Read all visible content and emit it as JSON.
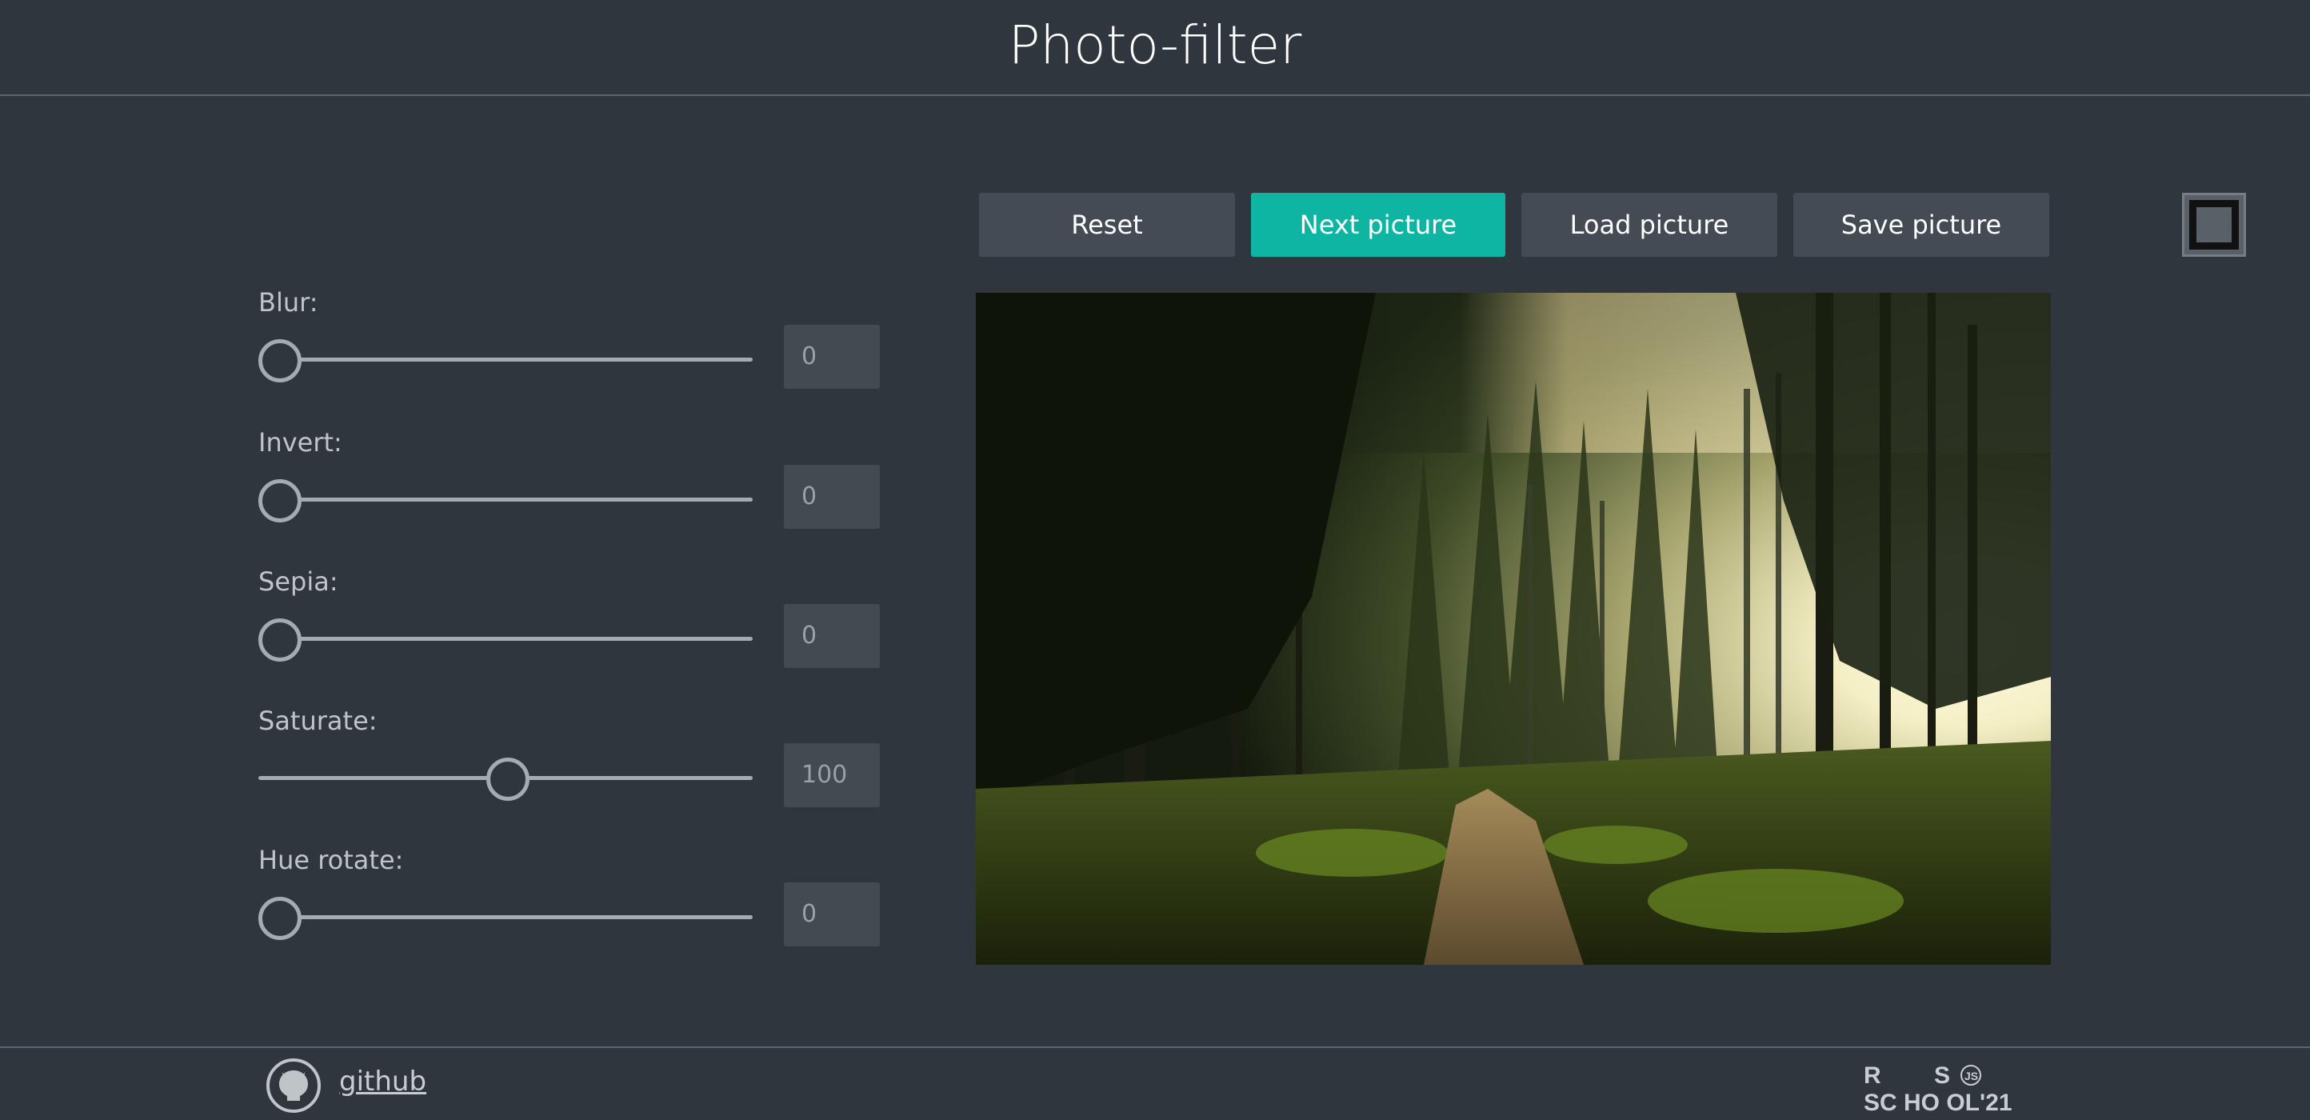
{
  "header": {
    "title": "Photo-filter"
  },
  "filters": [
    {
      "label": "Blur:",
      "value": "0",
      "fraction": 0.0
    },
    {
      "label": "Invert:",
      "value": "0",
      "fraction": 0.0
    },
    {
      "label": "Sepia:",
      "value": "0",
      "fraction": 0.0
    },
    {
      "label": "Saturate:",
      "value": "100",
      "fraction": 0.5
    },
    {
      "label": "Hue rotate:",
      "value": "0",
      "fraction": 0.0
    }
  ],
  "buttons": {
    "reset": "Reset",
    "next": "Next picture",
    "load": "Load picture",
    "save": "Save picture"
  },
  "colors": {
    "background": "#2f363e",
    "accent": "#0fb5a3",
    "button": "#444b54"
  },
  "icons": {
    "fullscreen": "fullscreen-icon",
    "github": "github-icon"
  },
  "footer": {
    "github_label": "github",
    "logo_text": "RS SCHOOL'21"
  }
}
